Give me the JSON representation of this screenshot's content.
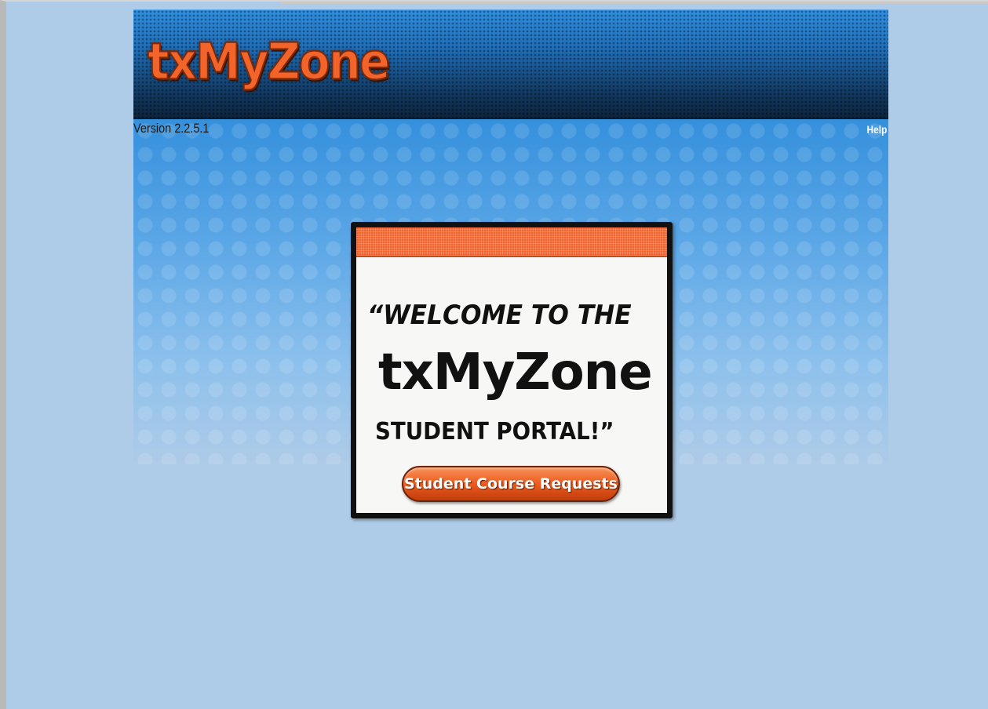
{
  "header": {
    "logo_text": "txMyZone",
    "version": "Version 2.2.5.1",
    "help_label": "Help"
  },
  "welcome": {
    "line1": "“WELCOME TO THE",
    "line2": "txMyZone",
    "line3": "STUDENT PORTAL!”",
    "button_label": "Student Course Requests"
  },
  "colors": {
    "page_background": "#aecbe8",
    "brand_orange": "#f2642a",
    "banner_dark": "#0c223a"
  }
}
